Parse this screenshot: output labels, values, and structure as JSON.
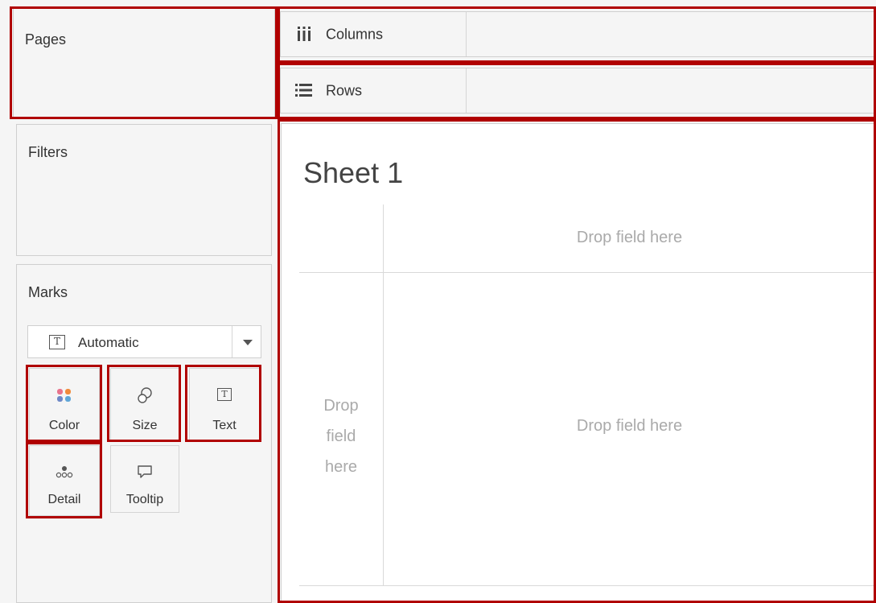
{
  "pages": {
    "title": "Pages"
  },
  "filters": {
    "title": "Filters"
  },
  "shelves": {
    "columns": {
      "label": "Columns",
      "icon": "columns-icon"
    },
    "rows": {
      "label": "Rows",
      "icon": "rows-icon"
    }
  },
  "marks": {
    "title": "Marks",
    "mark_type": {
      "value": "Automatic",
      "icon": "text-mark-icon"
    },
    "buttons": [
      {
        "label": "Color",
        "icon": "color-icon"
      },
      {
        "label": "Size",
        "icon": "size-icon"
      },
      {
        "label": "Text",
        "icon": "text-icon"
      },
      {
        "label": "Detail",
        "icon": "detail-icon"
      },
      {
        "label": "Tooltip",
        "icon": "tooltip-icon"
      }
    ]
  },
  "view": {
    "sheet_title": "Sheet 1",
    "drop_columns": "Drop field here",
    "drop_rows": "Drop\nfield\nhere",
    "drop_main": "Drop field here"
  },
  "colors": {
    "highlight": "#b00000",
    "drop_text": "#aaaaaa"
  }
}
